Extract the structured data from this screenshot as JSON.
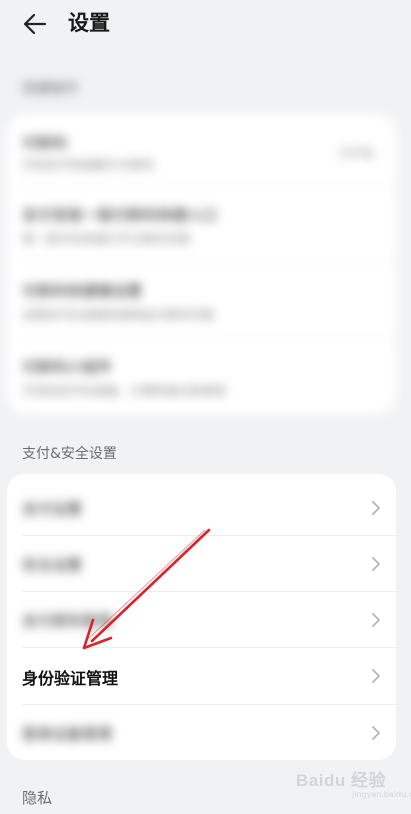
{
  "header": {
    "title": "设置"
  },
  "sections": {
    "shortcuts": {
      "label": "快捷操作",
      "items": [
        {
          "title": "付款码",
          "subtitle": "开启后可快速展示付款码",
          "value": "已开启"
        },
        {
          "title": "支付宝摇一摇付款码快捷入口",
          "subtitle": "摇一摇手机快速打开付款码页面",
          "value": ""
        },
        {
          "title": "付款码快捷键设置",
          "subtitle": "设置后可在桌面快速唤起付款码页面",
          "value": ""
        },
        {
          "title": "付款码小组件",
          "subtitle": "可添加至手机桌面，方便快速付款使用",
          "value": ""
        }
      ]
    },
    "payment_security": {
      "label": "支付&安全设置",
      "items": [
        {
          "label": "支付设置",
          "blurred": true
        },
        {
          "label": "安全设置",
          "blurred": true
        },
        {
          "label": "支付密码管理",
          "blurred": true
        },
        {
          "label": "身份验证管理",
          "blurred": false
        },
        {
          "label": "登录设备管理",
          "blurred": true
        }
      ]
    },
    "privacy": {
      "label": "隐私"
    }
  },
  "watermark": {
    "text": "Baidu 经验",
    "sub": "jingyan.baidu.com"
  },
  "colors": {
    "background": "#f1f2f4",
    "card": "#ffffff",
    "annotation_arrow": "#d9232b"
  }
}
